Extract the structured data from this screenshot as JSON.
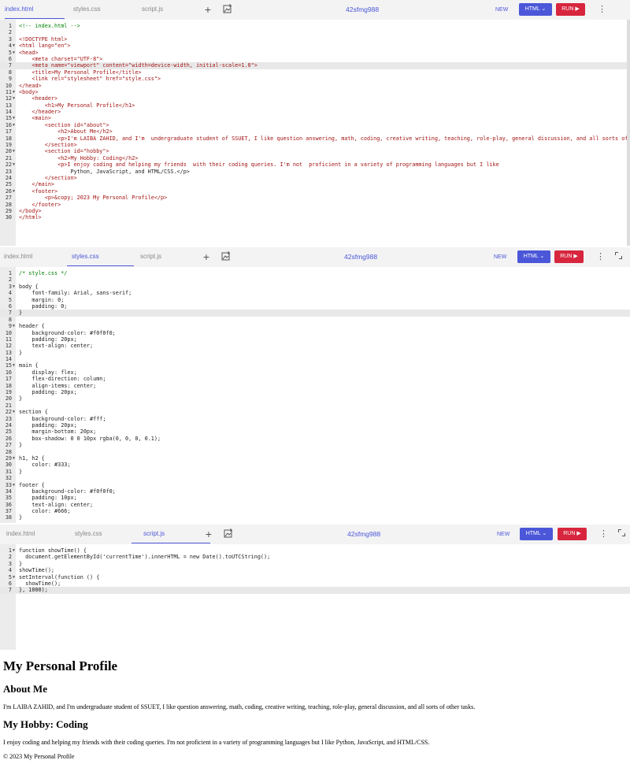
{
  "panels": [
    {
      "tabs": [
        "index.html",
        "styles.css",
        "script.js"
      ],
      "active": 0,
      "project": "42sfmg988",
      "new_label": "NEW",
      "lang_label": "HTML",
      "run_label": "RUN",
      "highlight": 7,
      "lines": [
        {
          "t": "<!-- index.html -->",
          "f": false
        },
        {
          "t": "",
          "f": false
        },
        {
          "t": "<!DOCTYPE html>",
          "f": false
        },
        {
          "t": "<html lang=\"en\">",
          "f": true
        },
        {
          "t": "<head>",
          "f": true
        },
        {
          "t": "    <meta charset=\"UTF-8\">",
          "f": false
        },
        {
          "t": "    <meta name=\"viewport\" content=\"width=device-width, initial-scale=1.0\">",
          "f": false
        },
        {
          "t": "    <title>My Personal Profile</title>",
          "f": false
        },
        {
          "t": "    <link rel=\"stylesheet\" href=\"style.css\">",
          "f": false
        },
        {
          "t": "</head>",
          "f": false
        },
        {
          "t": "<body>",
          "f": true
        },
        {
          "t": "    <header>",
          "f": true
        },
        {
          "t": "        <h1>My Personal Profile</h1>",
          "f": false
        },
        {
          "t": "    </header>",
          "f": false
        },
        {
          "t": "    <main>",
          "f": true
        },
        {
          "t": "        <section id=\"about\">",
          "f": true
        },
        {
          "t": "            <h2>About Me</h2>",
          "f": false
        },
        {
          "t": "            <p>I'm LAIBA ZAHID, and I'm  undergraduate student of SSUET, I like question answering, math, coding, creative writing, teaching, role-play, general discussion, and all sorts of",
          "f": false
        },
        {
          "t": "        </section>",
          "f": false
        },
        {
          "t": "        <section id=\"hobby\">",
          "f": true
        },
        {
          "t": "            <h2>My Hobby: Coding</h2>",
          "f": false
        },
        {
          "t": "            <p>I enjoy coding and helping my friends  with their coding queries. I'm not  proficient in a variety of programming languages but I like",
          "f": true
        },
        {
          "t": "                Python, JavaScript, and HTML/CSS.</p>",
          "f": false
        },
        {
          "t": "        </section>",
          "f": false
        },
        {
          "t": "    </main>",
          "f": false
        },
        {
          "t": "    <footer>",
          "f": true
        },
        {
          "t": "        <p>&copy; 2023 My Personal Profile</p>",
          "f": false
        },
        {
          "t": "    </footer>",
          "f": false
        },
        {
          "t": "</body>",
          "f": false
        },
        {
          "t": "</html>",
          "f": false
        }
      ]
    },
    {
      "tabs": [
        "index.html",
        "styles.css",
        "script.js"
      ],
      "active": 1,
      "project": "42sfmg988",
      "new_label": "NEW",
      "lang_label": "HTML",
      "run_label": "RUN",
      "highlight": 7,
      "lines": [
        {
          "t": "/* style.css */",
          "f": false
        },
        {
          "t": "",
          "f": false
        },
        {
          "t": "body {",
          "f": true
        },
        {
          "t": "    font-family: Arial, sans-serif;",
          "f": false
        },
        {
          "t": "    margin: 0;",
          "f": false
        },
        {
          "t": "    padding: 0;",
          "f": false
        },
        {
          "t": "}",
          "f": false
        },
        {
          "t": "",
          "f": false
        },
        {
          "t": "header {",
          "f": true
        },
        {
          "t": "    background-color: #f0f0f0;",
          "f": false
        },
        {
          "t": "    padding: 20px;",
          "f": false
        },
        {
          "t": "    text-align: center;",
          "f": false
        },
        {
          "t": "}",
          "f": false
        },
        {
          "t": "",
          "f": false
        },
        {
          "t": "main {",
          "f": true
        },
        {
          "t": "    display: flex;",
          "f": false
        },
        {
          "t": "    flex-direction: column;",
          "f": false
        },
        {
          "t": "    align-items: center;",
          "f": false
        },
        {
          "t": "    padding: 20px;",
          "f": false
        },
        {
          "t": "}",
          "f": false
        },
        {
          "t": "",
          "f": false
        },
        {
          "t": "section {",
          "f": true
        },
        {
          "t": "    background-color: #fff;",
          "f": false
        },
        {
          "t": "    padding: 20px;",
          "f": false
        },
        {
          "t": "    margin-bottom: 20px;",
          "f": false
        },
        {
          "t": "    box-shadow: 0 0 10px rgba(0, 0, 0, 0.1);",
          "f": false
        },
        {
          "t": "}",
          "f": false
        },
        {
          "t": "",
          "f": false
        },
        {
          "t": "h1, h2 {",
          "f": true
        },
        {
          "t": "    color: #333;",
          "f": false
        },
        {
          "t": "}",
          "f": false
        },
        {
          "t": "",
          "f": false
        },
        {
          "t": "footer {",
          "f": true
        },
        {
          "t": "    background-color: #f0f0f0;",
          "f": false
        },
        {
          "t": "    padding: 10px;",
          "f": false
        },
        {
          "t": "    text-align: center;",
          "f": false
        },
        {
          "t": "    color: #666;",
          "f": false
        },
        {
          "t": "}",
          "f": false
        }
      ]
    },
    {
      "tabs": [
        "index.html",
        "styles.css",
        "script.js"
      ],
      "active": 2,
      "project": "42sfmg988",
      "new_label": "NEW",
      "lang_label": "HTML",
      "run_label": "RUN",
      "highlight": 7,
      "lines": [
        {
          "t": "function showTime() {",
          "f": true
        },
        {
          "t": "  document.getElementById('currentTime').innerHTML = new Date().toUTCString();",
          "f": false
        },
        {
          "t": "}",
          "f": false
        },
        {
          "t": "showTime();",
          "f": false
        },
        {
          "t": "setInterval(function () {",
          "f": true
        },
        {
          "t": "  showTime();",
          "f": false
        },
        {
          "t": "}, 1000);",
          "f": false
        }
      ]
    }
  ],
  "preview": {
    "h1": "My Personal Profile",
    "about_title": "About Me",
    "about_text": "I'm LAIBA ZAHID, and I'm undergraduate student of SSUET, I like question answering, math, coding, creative writing, teaching, role-play, general discussion, and all sorts of other tasks.",
    "hobby_title": "My Hobby: Coding",
    "hobby_text": "I enjoy coding and helping my friends with their coding queries. I'm not proficient in a variety of programming languages but I like Python, JavaScript, and HTML/CSS.",
    "footer": "© 2023 My Personal Profile"
  },
  "colors": {
    "accent": "#4b57d8",
    "run": "#d7263d",
    "tag": "#a31515",
    "attr": "#ff0000",
    "string": "#0000ff",
    "comment": "#008000",
    "keyword": "#0000ff"
  }
}
